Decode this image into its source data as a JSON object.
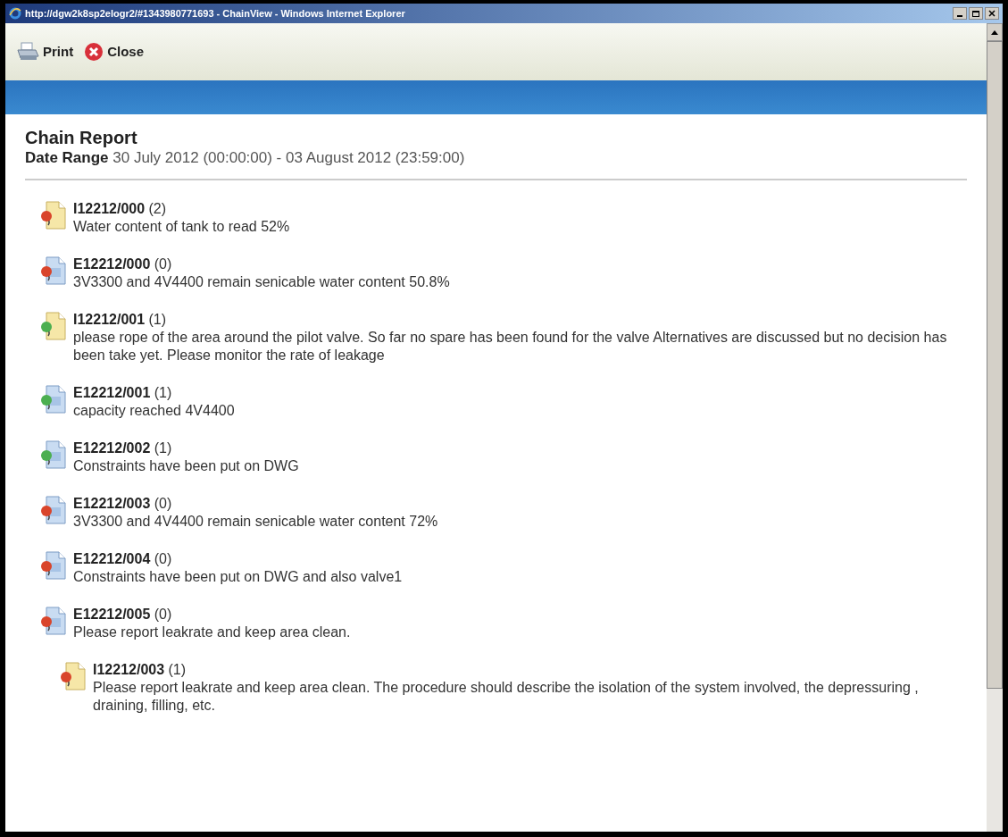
{
  "window": {
    "title": "http://dgw2k8sp2elogr2/#1343980771693 - ChainView - Windows Internet Explorer"
  },
  "toolbar": [
    {
      "kind": "print",
      "label": "Print"
    },
    {
      "kind": "close",
      "label": "Close"
    }
  ],
  "report": {
    "title": "Chain Report",
    "date_label": "Date Range",
    "date_value": "30 July 2012 (00:00:00) - 03 August 2012 (23:59:00)"
  },
  "items": [
    {
      "kind": "I",
      "color": "#d9452b",
      "code": "I12212/000",
      "count": "(2)",
      "text": "Water content of tank to read 52%"
    },
    {
      "kind": "E",
      "color": "#d9452b",
      "code": "E12212/000",
      "count": "(0)",
      "text": "3V3300 and 4V4400 remain senicable water content 50.8%"
    },
    {
      "kind": "I",
      "color": "#4caf50",
      "code": "I12212/001",
      "count": "(1)",
      "text": "please rope of the area around the pilot valve. So far no spare has been found for the valve Alternatives are discussed but no decision has been take yet. Please monitor the rate of leakage"
    },
    {
      "kind": "E",
      "color": "#4caf50",
      "code": "E12212/001",
      "count": "(1)",
      "text": "capacity reached 4V4400"
    },
    {
      "kind": "E",
      "color": "#4caf50",
      "code": "E12212/002",
      "count": "(1)",
      "text": "Constraints have been put on DWG"
    },
    {
      "kind": "E",
      "color": "#d9452b",
      "code": "E12212/003",
      "count": "(0)",
      "text": "3V3300 and 4V4400 remain senicable water content 72%"
    },
    {
      "kind": "E",
      "color": "#d9452b",
      "code": "E12212/004",
      "count": "(0)",
      "text": "Constraints have been put on DWG and also valve1"
    },
    {
      "kind": "E",
      "color": "#d9452b",
      "code": "E12212/005",
      "count": "(0)",
      "text": "Please report leakrate and keep area clean.",
      "children": [
        {
          "kind": "I",
          "color": "#d9452b",
          "code": "I12212/003",
          "count": "(1)",
          "text": "Please report leakrate and keep area clean. The procedure should describe the isolation of the system involved, the depressuring , draining, filling, etc."
        }
      ]
    }
  ]
}
